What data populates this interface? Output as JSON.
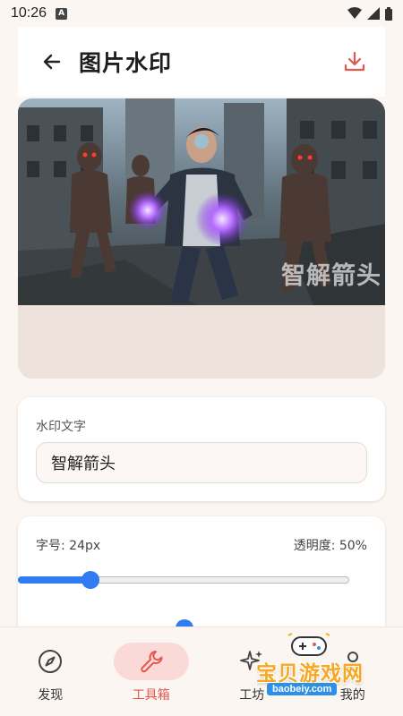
{
  "status_bar": {
    "time": "10:26",
    "notification_letter": "A"
  },
  "app_bar": {
    "title": "图片水印"
  },
  "preview": {
    "watermark_text": "智解箭头"
  },
  "text_card": {
    "label": "水印文字",
    "value": "智解箭头"
  },
  "slider_card": {
    "font_size_label": "字号: 24px",
    "opacity_label": "透明度: 50%",
    "font_size_fraction": 0.22
  },
  "bottom_nav": {
    "items": [
      {
        "label": "发现",
        "icon": "compass-icon"
      },
      {
        "label": "工具箱",
        "icon": "wrench-icon",
        "active": true
      },
      {
        "label": "工坊",
        "icon": "sparkle-icon"
      },
      {
        "label": "我的",
        "icon": "person-icon"
      }
    ]
  },
  "site_badge": {
    "name": "宝贝游戏网",
    "url": "baobeiy.com"
  },
  "colors": {
    "accent": "#e4574e",
    "slider": "#2f7bf2",
    "nav_active_bg": "#fbd9d6"
  }
}
